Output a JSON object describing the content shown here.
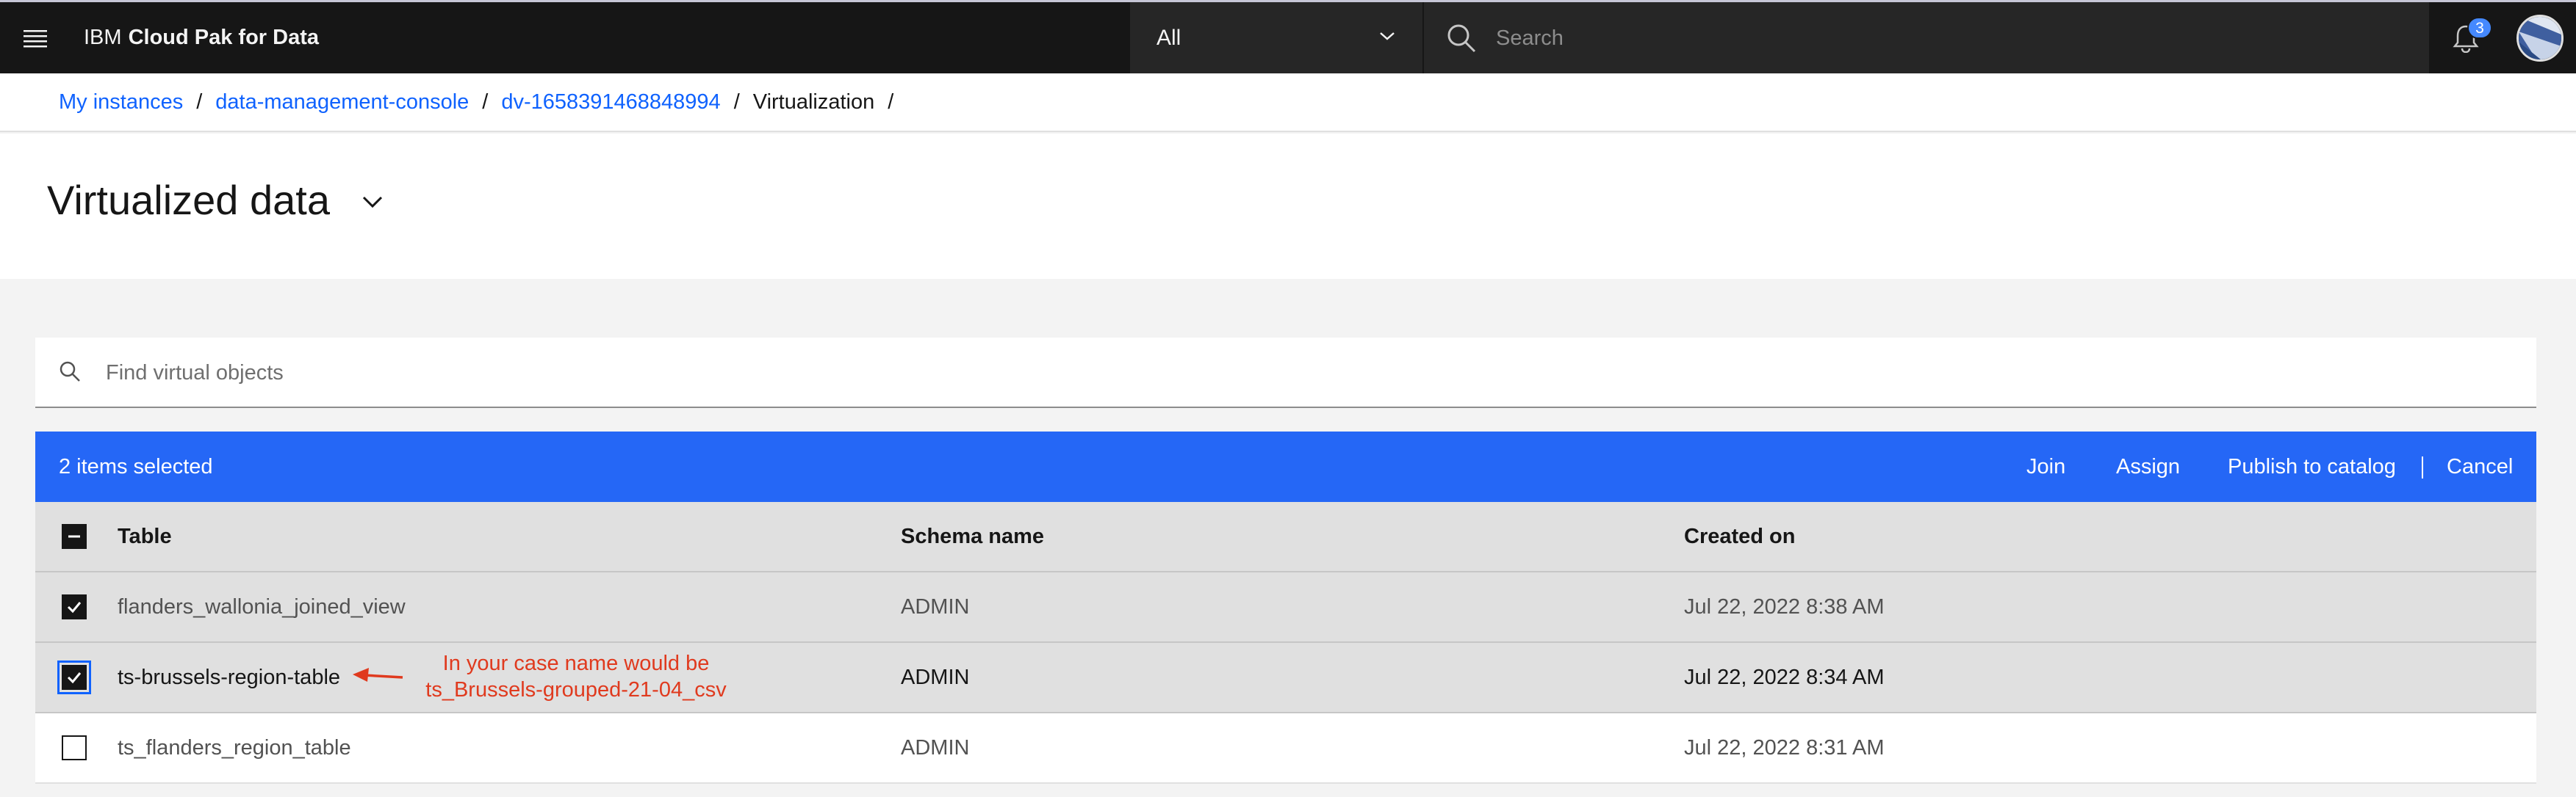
{
  "header": {
    "brand_prefix": "IBM",
    "brand_name": "Cloud Pak for Data",
    "scope_value": "All",
    "search_placeholder": "Search",
    "notification_count": "3"
  },
  "breadcrumb": {
    "items": [
      "My instances",
      "data-management-console",
      "dv-1658391468848994"
    ],
    "current": "Virtualization",
    "separator": "/"
  },
  "page": {
    "title": "Virtualized data"
  },
  "search": {
    "placeholder": "Find virtual objects"
  },
  "batch_actions": {
    "selected_text": "2 items selected",
    "join": "Join",
    "assign": "Assign",
    "publish": "Publish to catalog",
    "cancel": "Cancel"
  },
  "table": {
    "columns": [
      "Table",
      "Schema name",
      "Created on"
    ],
    "rows": [
      {
        "table": "flanders_wallonia_joined_view",
        "schema": "ADMIN",
        "created": "Jul 22, 2022 8:38 AM",
        "selected": true
      },
      {
        "table": "ts-brussels-region-table",
        "schema": "ADMIN",
        "created": "Jul 22, 2022 8:34 AM",
        "selected": true
      },
      {
        "table": "ts_flanders_region_table",
        "schema": "ADMIN",
        "created": "Jul 22, 2022 8:31 AM",
        "selected": false
      }
    ]
  },
  "annotation": {
    "line1": "In your case name would be",
    "line2": "ts_Brussels-grouped-21-04_csv",
    "color": "#e03a1e"
  },
  "colors": {
    "header_bg": "#161616",
    "batch_bar": "#2567f6",
    "link": "#0f62fe"
  }
}
